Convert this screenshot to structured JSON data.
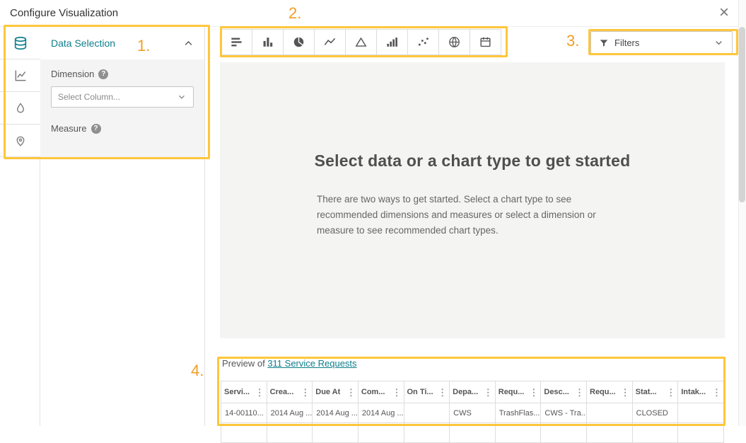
{
  "header": {
    "title": "Configure Visualization"
  },
  "icons": {
    "close": "×",
    "kebab": "⋮",
    "help": "?"
  },
  "sidebar": {
    "items": [
      {
        "name": "data",
        "selected": true
      },
      {
        "name": "axis-chart",
        "selected": false
      },
      {
        "name": "region-map",
        "selected": false
      },
      {
        "name": "point-map",
        "selected": false
      }
    ]
  },
  "panel": {
    "title": "Data Selection",
    "dimension_label": "Dimension",
    "measure_label": "Measure",
    "dropdown_placeholder": "Select Column..."
  },
  "toolbar": {
    "buttons": [
      {
        "name": "bar-chart"
      },
      {
        "name": "column-chart"
      },
      {
        "name": "pie-chart"
      },
      {
        "name": "line-chart"
      },
      {
        "name": "area-chart"
      },
      {
        "name": "histogram"
      },
      {
        "name": "scatter-plot"
      },
      {
        "name": "map"
      },
      {
        "name": "calendar"
      }
    ]
  },
  "filters": {
    "label": "Filters"
  },
  "canvas": {
    "heading": "Select data or a chart type to get started",
    "body": "There are two ways to get started. Select a chart type to see recommended dimensions and measures or select a dimension or measure to see recommended chart types."
  },
  "preview": {
    "label_prefix": "Preview of ",
    "link": "311 Service Requests",
    "columns": [
      "Servi...",
      "Crea...",
      "Due At",
      "Com...",
      "On Ti...",
      "Depa...",
      "Requ...",
      "Desc...",
      "Requ...",
      "Stat...",
      "Intak..."
    ],
    "row": [
      "14-00110...",
      "2014 Aug ...",
      "2014 Aug ...",
      "2014 Aug ...",
      "",
      "CWS",
      "TrashFlas...",
      "CWS - Tra...",
      "",
      "CLOSED",
      ""
    ]
  },
  "annotations": {
    "n1": "1.",
    "n2": "2.",
    "n3": "3.",
    "n4": "4."
  },
  "colors": {
    "accent": "#0f7e8b",
    "annotation_border": "#ffc63c",
    "annotation_text": "#f29d25",
    "canvas_bg": "#f4f4f3"
  }
}
